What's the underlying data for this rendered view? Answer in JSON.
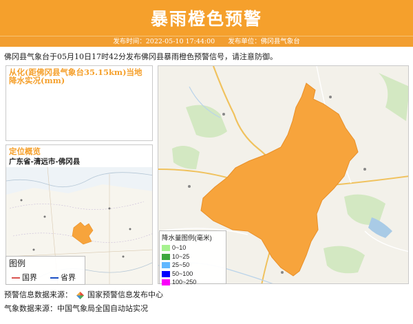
{
  "header": {
    "title": "暴雨橙色预警",
    "publish_time": "发布时间：2022-05-10 17:44:00",
    "publisher": "发布单位：佛冈县气象台"
  },
  "notice": "佛冈县气象台于05月10日17时42分发布佛冈县暴雨橙色预警信号，请注意防御。",
  "rain_panel": {
    "title": "从化(距佛冈县气象台35.15km)当地降水实况(mm)"
  },
  "location_panel": {
    "title": "定位概览",
    "subtitle": "广东省-清远市-佛冈县"
  },
  "boundary_legend": {
    "title": "图例",
    "items": [
      {
        "label": "国界",
        "color": "#d9534f"
      },
      {
        "label": "省界",
        "color": "#1a4fc4"
      }
    ]
  },
  "rain_legend": {
    "title": "降水量图例(毫米)",
    "items": [
      {
        "label": "0~10",
        "color": "#a6f28f"
      },
      {
        "label": "10~25",
        "color": "#3da83d"
      },
      {
        "label": "25~50",
        "color": "#61b8ff"
      },
      {
        "label": "50~100",
        "color": "#0000fe"
      },
      {
        "label": "100~250",
        "color": "#fa00fa"
      }
    ]
  },
  "footer": {
    "alert_source_label": "预警信息数据来源：",
    "alert_source": "国家预警信息发布中心",
    "weather_source": "气象数据来源：中国气象局全国自动站实况"
  },
  "colors": {
    "brand": "#f5a02c",
    "warning_area": "#f7a43c"
  }
}
